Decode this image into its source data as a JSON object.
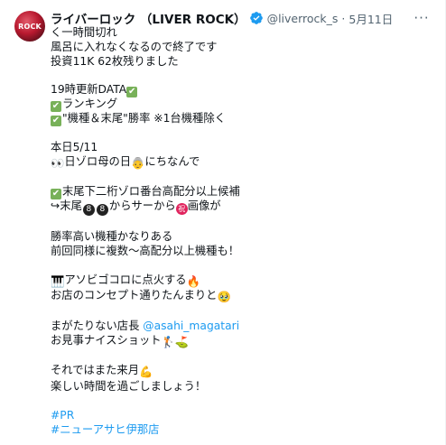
{
  "author": {
    "display_name": "ライバーロック （LIVER ROCK）",
    "handle": "@liverrock_s",
    "separator": "·",
    "date": "5月11日",
    "avatar_text": "ROCK"
  },
  "more_label": "···",
  "lines": {
    "l1": "く一時間切れ",
    "l2": "風呂に入れなくなるので終了です",
    "l3": "投資11K 62枚残りました",
    "l4": "19時更新DATA",
    "l5": "ランキング",
    "l6": "\"機種＆末尾\"勝率 ※1台機種除く",
    "l7": "本日5/11",
    "l8a": "👀",
    "l8b": "日ゾロ母の日",
    "l8c": "にちなんで",
    "l9": "末尾下二桁ゾロ番台高配分以上候補",
    "l10a": "↪末尾",
    "l10b": "からサーから",
    "l10c": "画像が",
    "l11": "勝率高い機種かなりある",
    "l12": "前回同様に複数〜高配分以上機種も！",
    "l13a": "アソビゴコロに点火する",
    "l14a": "お店のコンセプト通りたんまりと",
    "l15a": "まがたりない店長 ",
    "l15link": "@asahi_magatari",
    "l16a": "お見事ナイスショット",
    "l17a": "それではまた来月",
    "l18": "楽しい時間を過ごしましょう！",
    "tag1": "#PR",
    "tag2": "#ニューアサヒ伊那店"
  },
  "colors": {
    "link": "#1d9bf0",
    "verified": "#1d9bf0",
    "check_emoji": "#78b159"
  }
}
